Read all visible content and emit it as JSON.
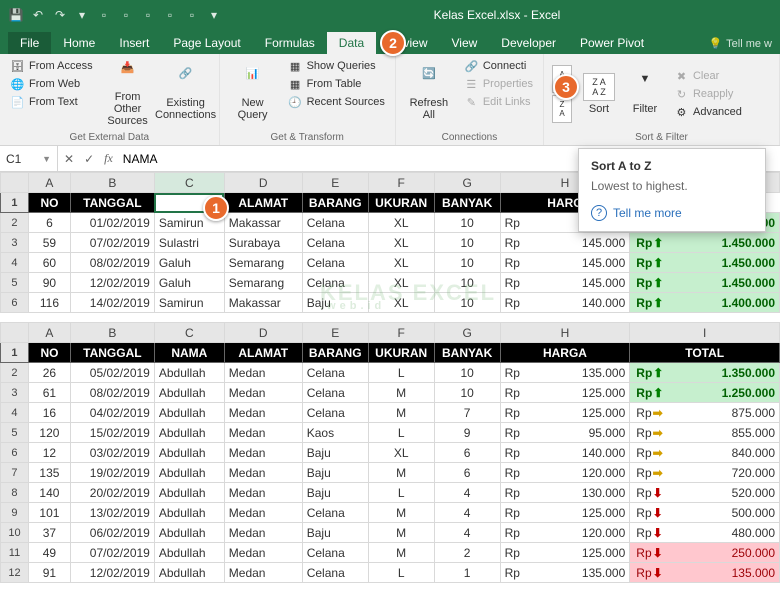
{
  "app": {
    "title": "Kelas Excel.xlsx - Excel"
  },
  "qat": {
    "save": "💾",
    "undo": "↶",
    "redo": "↷"
  },
  "menu": {
    "file": "File",
    "home": "Home",
    "insert": "Insert",
    "page_layout": "Page Layout",
    "formulas": "Formulas",
    "data": "Data",
    "review": "Review",
    "view": "View",
    "developer": "Developer",
    "power_pivot": "Power Pivot",
    "tell_me": "Tell me w"
  },
  "ribbon": {
    "g1": {
      "from_access": "From Access",
      "from_web": "From Web",
      "from_text": "From Text",
      "from_other": "From Other Sources",
      "existing": "Existing Connections",
      "label": "Get External Data"
    },
    "g2": {
      "new_query": "New Query",
      "show_queries": "Show Queries",
      "from_table": "From Table",
      "recent_sources": "Recent Sources",
      "label": "Get & Transform"
    },
    "g3": {
      "refresh": "Refresh All",
      "connections": "Connecti",
      "properties": "Properties",
      "edit_links": "Edit Links",
      "label": "Connections"
    },
    "g4": {
      "sort": "Sort",
      "filter": "Filter",
      "clear": "Clear",
      "reapply": "Reapply",
      "advanced": "Advanced",
      "label": "Sort & Filter"
    }
  },
  "fbar": {
    "cell": "C1",
    "fx": "fx",
    "value": "NAMA"
  },
  "cols": [
    "A",
    "B",
    "C",
    "D",
    "E",
    "F",
    "G",
    "H",
    "I"
  ],
  "headers": {
    "no": "NO",
    "tanggal": "TANGGAL",
    "nama": "NAMA",
    "alamat": "ALAMAT",
    "barang": "BARANG",
    "ukuran": "UKURAN",
    "banyak": "BANYAK",
    "harga": "HARGA",
    "total": "TOTAL"
  },
  "table1": [
    {
      "r": "2",
      "no": "6",
      "tgl": "01/02/2019",
      "nm": "Samirun",
      "al": "Makassar",
      "br": "Celana",
      "uk": "XL",
      "bk": "10",
      "rp": "Rp",
      "hr": "145.000",
      "ar": "up",
      "trp": "Rp",
      "tt": "1.450.000"
    },
    {
      "r": "3",
      "no": "59",
      "tgl": "07/02/2019",
      "nm": "Sulastri",
      "al": "Surabaya",
      "br": "Celana",
      "uk": "XL",
      "bk": "10",
      "rp": "Rp",
      "hr": "145.000",
      "ar": "up",
      "trp": "Rp",
      "tt": "1.450.000"
    },
    {
      "r": "4",
      "no": "60",
      "tgl": "08/02/2019",
      "nm": "Galuh",
      "al": "Semarang",
      "br": "Celana",
      "uk": "XL",
      "bk": "10",
      "rp": "Rp",
      "hr": "145.000",
      "ar": "up",
      "trp": "Rp",
      "tt": "1.450.000"
    },
    {
      "r": "5",
      "no": "90",
      "tgl": "12/02/2019",
      "nm": "Galuh",
      "al": "Semarang",
      "br": "Celana",
      "uk": "XL",
      "bk": "10",
      "rp": "Rp",
      "hr": "145.000",
      "ar": "up",
      "trp": "Rp",
      "tt": "1.450.000"
    },
    {
      "r": "6",
      "no": "116",
      "tgl": "14/02/2019",
      "nm": "Samirun",
      "al": "Makassar",
      "br": "Baju",
      "uk": "XL",
      "bk": "10",
      "rp": "Rp",
      "hr": "140.000",
      "ar": "up",
      "trp": "Rp",
      "tt": "1.400.000"
    }
  ],
  "table2": [
    {
      "r": "2",
      "no": "26",
      "tgl": "05/02/2019",
      "nm": "Abdullah",
      "al": "Medan",
      "br": "Celana",
      "uk": "L",
      "bk": "10",
      "rp": "Rp",
      "hr": "135.000",
      "ar": "up",
      "cf": "g",
      "trp": "Rp",
      "tt": "1.350.000"
    },
    {
      "r": "3",
      "no": "61",
      "tgl": "08/02/2019",
      "nm": "Abdullah",
      "al": "Medan",
      "br": "Celana",
      "uk": "M",
      "bk": "10",
      "rp": "Rp",
      "hr": "125.000",
      "ar": "up",
      "cf": "g",
      "trp": "Rp",
      "tt": "1.250.000"
    },
    {
      "r": "4",
      "no": "16",
      "tgl": "04/02/2019",
      "nm": "Abdullah",
      "al": "Medan",
      "br": "Celana",
      "uk": "M",
      "bk": "7",
      "rp": "Rp",
      "hr": "125.000",
      "ar": "side",
      "cf": "y",
      "trp": "Rp",
      "tt": "875.000"
    },
    {
      "r": "5",
      "no": "120",
      "tgl": "15/02/2019",
      "nm": "Abdullah",
      "al": "Medan",
      "br": "Kaos",
      "uk": "L",
      "bk": "9",
      "rp": "Rp",
      "hr": "95.000",
      "ar": "side",
      "cf": "y",
      "trp": "Rp",
      "tt": "855.000"
    },
    {
      "r": "6",
      "no": "12",
      "tgl": "03/02/2019",
      "nm": "Abdullah",
      "al": "Medan",
      "br": "Baju",
      "uk": "XL",
      "bk": "6",
      "rp": "Rp",
      "hr": "140.000",
      "ar": "side",
      "cf": "y",
      "trp": "Rp",
      "tt": "840.000"
    },
    {
      "r": "7",
      "no": "135",
      "tgl": "19/02/2019",
      "nm": "Abdullah",
      "al": "Medan",
      "br": "Baju",
      "uk": "M",
      "bk": "6",
      "rp": "Rp",
      "hr": "120.000",
      "ar": "side",
      "cf": "y",
      "trp": "Rp",
      "tt": "720.000"
    },
    {
      "r": "8",
      "no": "140",
      "tgl": "20/02/2019",
      "nm": "Abdullah",
      "al": "Medan",
      "br": "Baju",
      "uk": "L",
      "bk": "4",
      "rp": "Rp",
      "hr": "130.000",
      "ar": "down",
      "cf": "n",
      "trp": "Rp",
      "tt": "520.000"
    },
    {
      "r": "9",
      "no": "101",
      "tgl": "13/02/2019",
      "nm": "Abdullah",
      "al": "Medan",
      "br": "Celana",
      "uk": "M",
      "bk": "4",
      "rp": "Rp",
      "hr": "125.000",
      "ar": "down",
      "cf": "n",
      "trp": "Rp",
      "tt": "500.000"
    },
    {
      "r": "10",
      "no": "37",
      "tgl": "06/02/2019",
      "nm": "Abdullah",
      "al": "Medan",
      "br": "Baju",
      "uk": "M",
      "bk": "4",
      "rp": "Rp",
      "hr": "120.000",
      "ar": "down",
      "cf": "n",
      "trp": "Rp",
      "tt": "480.000"
    },
    {
      "r": "11",
      "no": "49",
      "tgl": "07/02/2019",
      "nm": "Abdullah",
      "al": "Medan",
      "br": "Celana",
      "uk": "M",
      "bk": "2",
      "rp": "Rp",
      "hr": "125.000",
      "ar": "down",
      "cf": "r",
      "trp": "Rp",
      "tt": "250.000"
    },
    {
      "r": "12",
      "no": "91",
      "tgl": "12/02/2019",
      "nm": "Abdullah",
      "al": "Medan",
      "br": "Celana",
      "uk": "L",
      "bk": "1",
      "rp": "Rp",
      "hr": "135.000",
      "ar": "down",
      "cf": "r",
      "trp": "Rp",
      "tt": "135.000"
    }
  ],
  "tooltip": {
    "title": "Sort A to Z",
    "body": "Lowest to highest.",
    "more": "Tell me more"
  },
  "badges": {
    "b1": "1",
    "b2": "2",
    "b3": "3"
  },
  "wm": {
    "big": "KELAS EXCEL",
    "small": ".web.id"
  }
}
